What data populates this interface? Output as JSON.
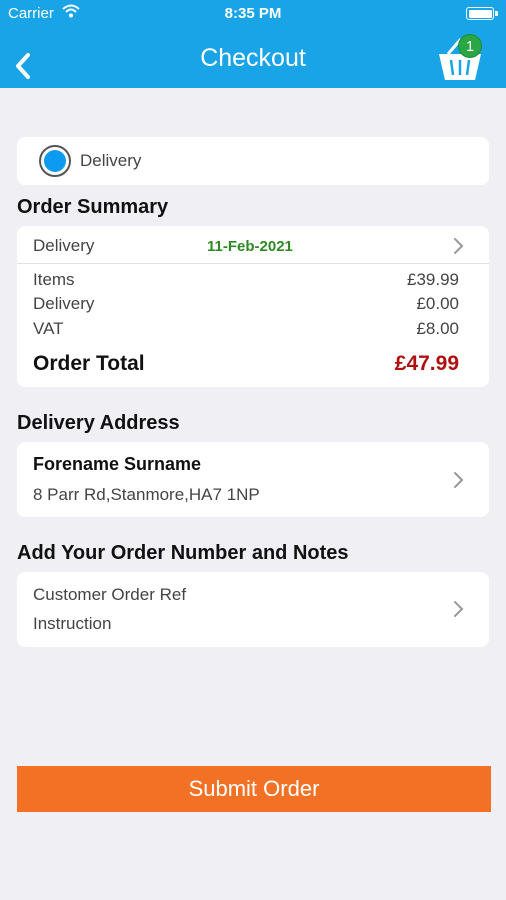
{
  "status_bar": {
    "carrier": "Carrier",
    "time": "8:35 PM"
  },
  "header": {
    "title": "Checkout",
    "cart_count": "1"
  },
  "delivery_option": {
    "label": "Delivery",
    "selected": true
  },
  "order_summary": {
    "title": "Order Summary",
    "delivery_label": "Delivery",
    "delivery_date": "11-Feb-2021",
    "lines": [
      {
        "label": "Items",
        "value": "£39.99"
      },
      {
        "label": "Delivery",
        "value": "£0.00"
      },
      {
        "label": "VAT",
        "value": "£8.00"
      }
    ],
    "total_label": "Order Total",
    "total_value": "£47.99"
  },
  "delivery_address": {
    "title": "Delivery Address",
    "name": "Forename Surname",
    "address": "8 Parr Rd,Stanmore,HA7 1NP"
  },
  "order_notes": {
    "title": "Add Your Order Number and Notes",
    "order_ref_label": "Customer Order Ref",
    "instruction_label": "Instruction"
  },
  "submit_label": "Submit Order",
  "colors": {
    "header": "#1aa4e8",
    "submit": "#f37125",
    "total": "#b01010",
    "date": "#2e8b22",
    "badge": "#29a745"
  }
}
